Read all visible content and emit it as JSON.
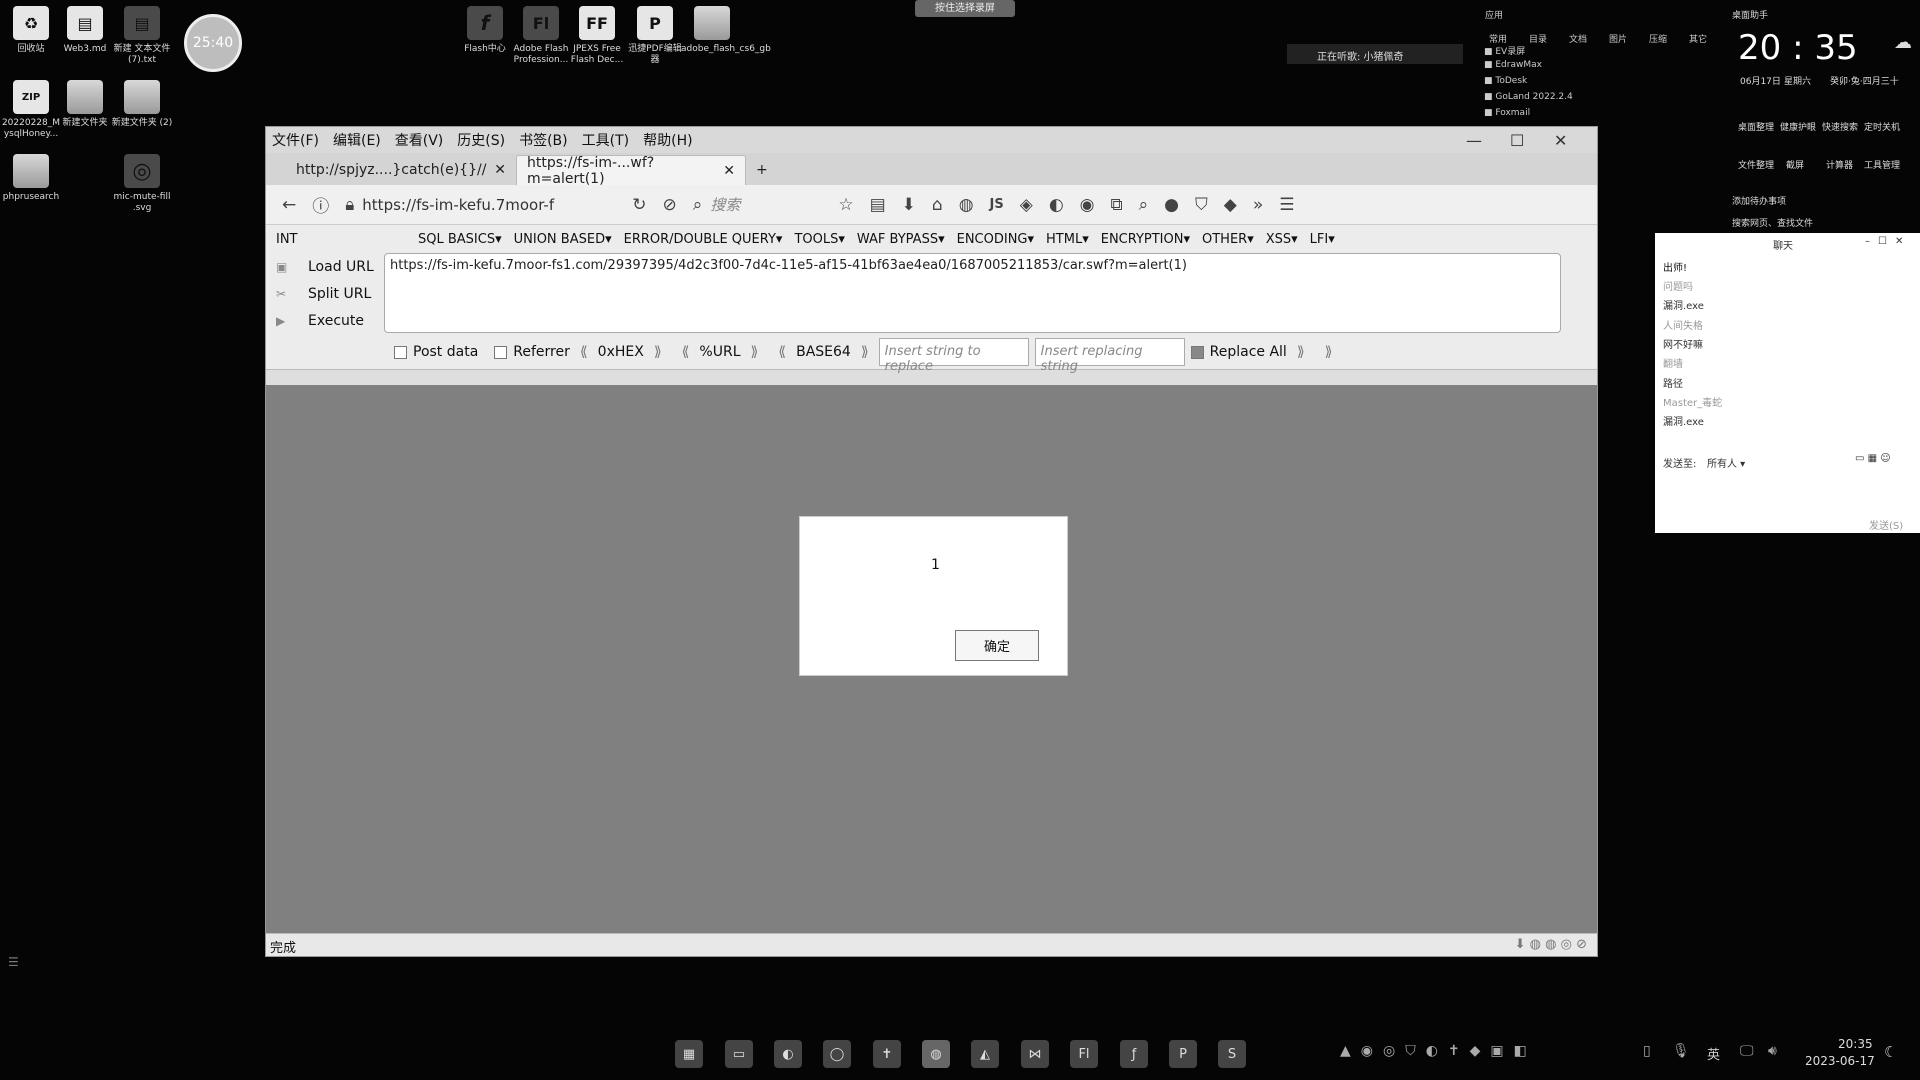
{
  "desktop_icons": [
    {
      "label": "回收站",
      "glyph": "♻"
    },
    {
      "label": "Web3.md",
      "glyph": "▤"
    },
    {
      "label": "新建 文本文件 (7).txt",
      "glyph": "▤"
    },
    {
      "label": "20220228_M ysqlHoney...",
      "glyph": "ZIP"
    },
    {
      "label": "新建文件夹",
      "glyph": ""
    },
    {
      "label": "新建文件夹 (2)",
      "glyph": ""
    },
    {
      "label": "phprusearch",
      "glyph": ""
    },
    {
      "label": "mic-mute-fill .svg",
      "glyph": "◎"
    },
    {
      "label": "Flash中心",
      "glyph": "f"
    },
    {
      "label": "Adobe Flash Profession...",
      "glyph": "Fl"
    },
    {
      "label": "JPEXS Free Flash Dec...",
      "glyph": "FF"
    },
    {
      "label": "迅捷PDF编辑器",
      "glyph": "P"
    },
    {
      "label": "adobe_flash_cs6_gb",
      "glyph": ""
    }
  ],
  "timer": "25:40",
  "top_notice": "按住选择录屏",
  "recording_status": "正在听歌: 小猪佩奇",
  "app_list": {
    "tabs": [
      "应用",
      "常用",
      "目录",
      "文档",
      "图片",
      "压缩",
      "其它"
    ],
    "items": [
      "EV录屏",
      "EdrawMax",
      "ToDesk",
      "GoLand 2022.2.4",
      "Foxmail"
    ]
  },
  "clock": {
    "assistant": "桌面助手",
    "time": "20 : 35",
    "date": "06月17日",
    "weekday": "星期六",
    "lunar": "癸卯·兔·四月三十",
    "quick": [
      "桌面整理",
      "健康护眼",
      "快速搜索",
      "定时关机",
      "文件整理",
      "截屏",
      "计算器",
      "工具管理"
    ],
    "add_event": "添加待办事项",
    "search": "搜索网页、查找文件"
  },
  "browser": {
    "menu": [
      "文件(F)",
      "编辑(E)",
      "查看(V)",
      "历史(S)",
      "书签(B)",
      "工具(T)",
      "帮助(H)"
    ],
    "tabs": [
      {
        "title": "http://spjyz....}catch(e){}//"
      },
      {
        "title": "https://fs-im-...wf?m=alert(1)"
      }
    ],
    "new_tab": "+",
    "address": "https://fs-im-kefu.7moor-f",
    "search_placeholder": "搜索",
    "hackbar": {
      "select": "INT",
      "menus": [
        "SQL BASICS▾",
        "UNION BASED▾",
        "ERROR/DOUBLE QUERY▾",
        "TOOLS▾",
        "WAF BYPASS▾",
        "ENCODING▾",
        "HTML▾",
        "ENCRYPTION▾",
        "OTHER▾",
        "XSS▾",
        "LFI▾"
      ],
      "load_url": "Load URL",
      "split_url": "Split URL",
      "execute": "Execute",
      "url_value": "https://fs-im-kefu.7moor-fs1.com/29397395/4d2c3f00-7d4c-11e5-af15-41bf63ae4ea0/1687005211853/car.swf?m=alert(1)",
      "post_data": "Post data",
      "referrer": "Referrer",
      "hex": "0xHEX",
      "url_enc": "%URL",
      "base64": "BASE64",
      "find_placeholder": "Insert string to replace",
      "replace_placeholder": "Insert replacing string",
      "replace_all": "Replace All"
    },
    "alert": {
      "message": "1",
      "ok": "确定"
    },
    "status": "完成"
  },
  "chat": {
    "title": "聊天",
    "lines": [
      "出师!",
      "问题吗",
      "漏洞.exe",
      "人间失格",
      "网不好嘛",
      "翻墙",
      "路径",
      "Master_毒蛇",
      "漏洞.exe"
    ],
    "send_to_label": "发送至:",
    "send_to_value": "所有人 ▾",
    "send_button": "发送(S)"
  },
  "taskbar": {
    "apps": [
      "▦",
      "▭",
      "◐",
      "◯",
      "✝",
      "◍",
      "◭",
      "⋈",
      "Fl",
      "ƒ",
      "P",
      "S"
    ],
    "tray_lang": "英",
    "time": "20:35",
    "date": "2023-06-17"
  }
}
